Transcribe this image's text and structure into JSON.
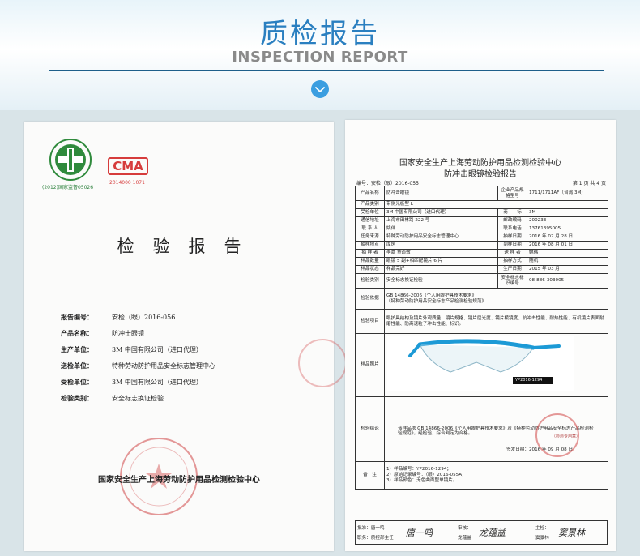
{
  "banner": {
    "cn_title": "质检报告",
    "en_title": "INSPECTION REPORT",
    "chevron_icon": "chevron-down-icon",
    "accent": "#2a7fc0"
  },
  "cover": {
    "logo1_caption": "(2012)国家监督05026",
    "logo2_mark": "CMA",
    "logo2_caption": "2014000 1071",
    "title": "检验报告",
    "rows": [
      {
        "label": "报告编号：",
        "value": "安检（眼）2016-056"
      },
      {
        "label": "产品名称：",
        "value": "防冲击眼镜"
      },
      {
        "label": "生产单位：",
        "value": "3M 中国有限公司（进口代理）"
      },
      {
        "label": "送检单位：",
        "value": "特种劳动防护用品安全标志管理中心"
      },
      {
        "label": "受检单位：",
        "value": "3M 中国有限公司（进口代理）"
      },
      {
        "label": "检验类别：",
        "value": "安全标志换证检验"
      }
    ],
    "footer": "国家安全生产上海劳动防护用品检测检验中心"
  },
  "report": {
    "org": "国家安全生产上海劳动防护用品检测检验中心",
    "title": "防冲击眼镜检验报告",
    "report_no": "编号：安检（眼）2016-055",
    "page": "第 1 页    共 4 页",
    "r1": {
      "l1": "产品名称",
      "v1": "防冲击眼镜",
      "l2": "企业产品规格型号",
      "v2": "1711/1711AF（台湾 3M）"
    },
    "r2": {
      "l1": "产品类别",
      "v1": "带侧光板型 L"
    },
    "r3": {
      "l1": "受检单位",
      "v1": "3M 中国有限公司（进口代理）",
      "l2": "商　　标",
      "v2": "3M"
    },
    "r4": {
      "l1": "通信地址",
      "v1": "上海市田林路 222 号",
      "l2": "邮政编码",
      "v2": "200233"
    },
    "r5": {
      "l1": "联 系 人",
      "v1": "姚伟",
      "l2": "联系电话",
      "v2": "13761395005"
    },
    "r6": {
      "l1": "任务来源",
      "v1": "特种劳动防护用品安全标志管理中心",
      "l2": "抽样日期",
      "v2": "2016 年 07 月 28 日"
    },
    "r7": {
      "l1": "抽样地点",
      "v1": "库房",
      "l2": "到样日期",
      "v2": "2016 年 08 月 01 日"
    },
    "r8": {
      "l1": "抽 样 者",
      "v1": "李嘉  童道效",
      "l2": "送 样 者",
      "v2": "姚伟"
    },
    "r9": {
      "l1": "样品数量",
      "v1": "眼镜 5 副+相匹配镜片 6 片",
      "l2": "抽样方式",
      "v2": "随机"
    },
    "r10": {
      "l1": "样品状态",
      "v1": "样品完好",
      "l2": "生产日期",
      "v2": "2015 年 03 月"
    },
    "r11": {
      "l1": "检验类别",
      "v1": "安全标志换证检验",
      "l2": "安全标志标识编号",
      "v2": "08-886-303005"
    },
    "r12": {
      "l1": "检验依据",
      "v1": "GB 14866-2006《个人用眼护具技术要求》",
      "v1b": "《特种劳动防护用品安全标志产品检测检验规范》"
    },
    "r13": {
      "l1": "检验项目",
      "v1": "眼护具结构及镜片外观质量、镜片规格、镜片屈光度、镜片棱镜度、抗冲击性能、耐热性能、有机镜片表面耐磨性能、防高速粒子冲击性能、标识。"
    },
    "r14": {
      "l1": "样品照片",
      "photo_label": "YP2016-1294"
    },
    "r15": {
      "l1": "检验结论",
      "v1": "该样品依 GB 14866-2006《个人用眼护具技术要求》及《特种劳动防护用品安全标志产品检测检验规范》，经检验，综合判定为合格。",
      "stamp_text": "（检验专用章）",
      "date": "签发日期：2016 年 09 月 08 日"
    },
    "r16": {
      "l1": "备　注",
      "n1": "1）样品编号：YP2016-1294；",
      "n2": "2）原始记录编号：（眼）2016-055A；",
      "n3": "3）样品颜色：无色曲面型单镜片。"
    },
    "sign": {
      "approve_label": "批准：唐一鸣",
      "approve_sub": "职务：质控部主任",
      "approve_sig": "唐一鸣",
      "review_label": "审核：",
      "review_sub": "龙蕴益",
      "review_sig": "龙蕴益",
      "main_label": "主检：",
      "main_sub": "窦景林",
      "main_sig": "窦景林"
    }
  },
  "colors": {
    "banner_rule": "#1e5f8a",
    "chevron_button": "#3b9ee0",
    "stamp_red": "#d04646",
    "logo_green": "#2f8a3c",
    "logo_red": "#d63c3c"
  }
}
